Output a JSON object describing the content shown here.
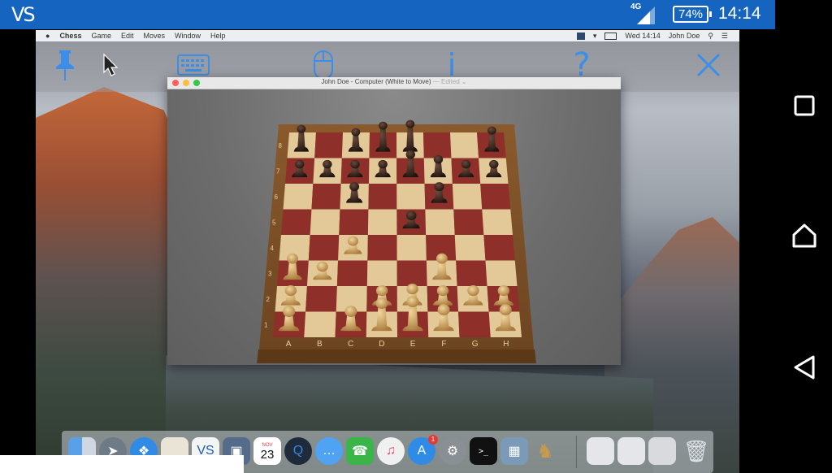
{
  "status_bar": {
    "app_icon": "VS",
    "network": "4G",
    "battery": "74%",
    "time": "14:14",
    "background": "#1565c0"
  },
  "mac_menu": {
    "apple": "",
    "app": "Chess",
    "items": [
      "Game",
      "Edit",
      "Moves",
      "Window",
      "Help"
    ],
    "clock": "Wed 14:14",
    "user": "John Doe"
  },
  "vnc_toolbar": {
    "icons": [
      "pin-icon",
      "pointer-icon",
      "keyboard-icon",
      "mouse-icon",
      "info-icon",
      "help-icon",
      "close-icon"
    ],
    "info_glyph": "i",
    "help_glyph": "?",
    "color": "#3d8ee8"
  },
  "chess_window": {
    "title": "John Doe - Computer   (White to Move)",
    "edited": " — Edited ⌄",
    "files": [
      "A",
      "B",
      "C",
      "D",
      "E",
      "F",
      "G",
      "H"
    ],
    "ranks": [
      "1",
      "2",
      "3",
      "4",
      "5",
      "6",
      "7",
      "8"
    ]
  },
  "dock": {
    "calendar_month": "NOV",
    "calendar_day": "23",
    "app_store_badge": "1",
    "terminal_prompt": ">_"
  },
  "nav_bar": {
    "buttons": [
      "recents-button",
      "home-button",
      "back-button"
    ]
  }
}
